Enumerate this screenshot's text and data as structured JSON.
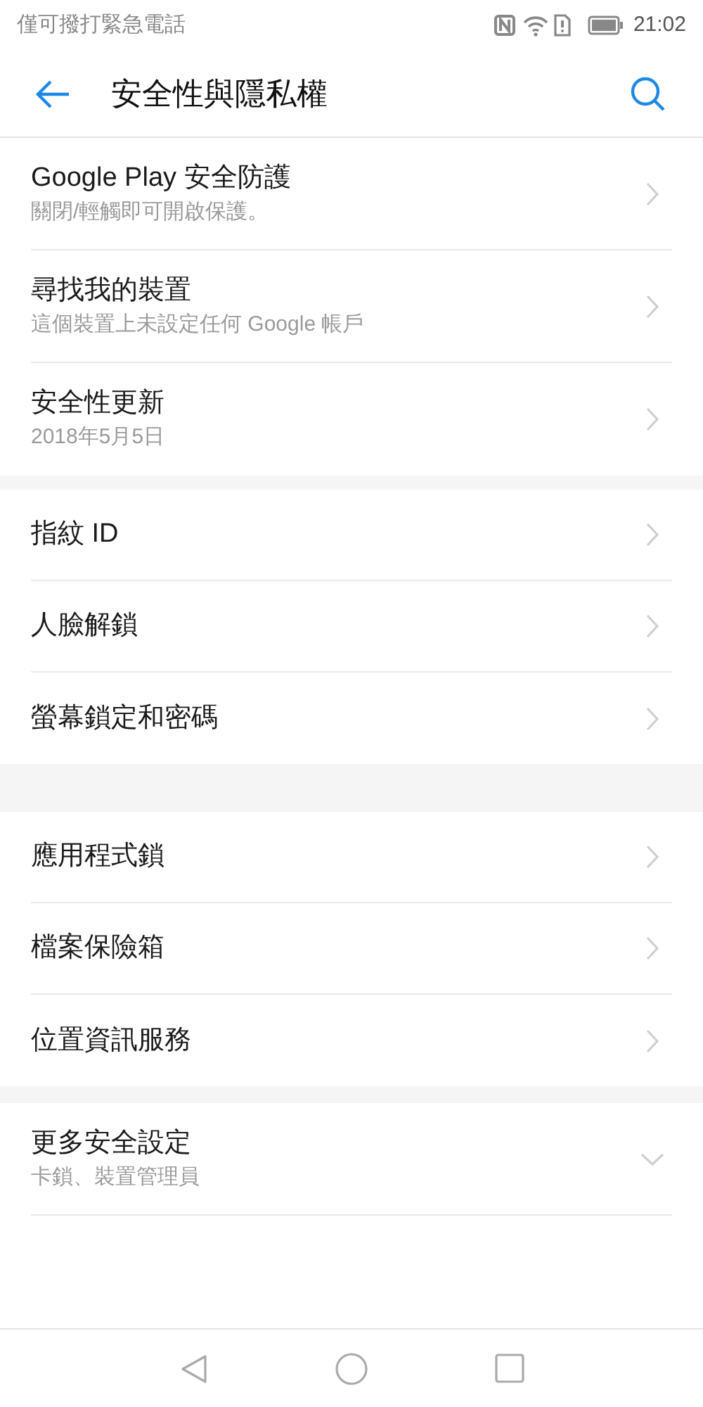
{
  "status_bar": {
    "carrier": "僅可撥打緊急電話",
    "time": "21:02"
  },
  "header": {
    "title": "安全性與隱私權"
  },
  "sections": [
    {
      "items": [
        {
          "kind": "link",
          "title": "Google Play 安全防護",
          "subtitle": "關閉/輕觸即可開啟保護。"
        },
        {
          "kind": "link",
          "title": "尋找我的裝置",
          "subtitle": "這個裝置上未設定任何 Google 帳戶"
        },
        {
          "kind": "link",
          "title": "安全性更新",
          "subtitle": "2018年5月5日"
        }
      ]
    },
    {
      "items": [
        {
          "kind": "link",
          "title": "指紋 ID"
        },
        {
          "kind": "link",
          "title": "人臉解鎖"
        },
        {
          "kind": "link",
          "title": "螢幕鎖定和密碼"
        }
      ]
    },
    {
      "items": [
        {
          "kind": "link",
          "title": "應用程式鎖"
        },
        {
          "kind": "link",
          "title": "檔案保險箱"
        },
        {
          "kind": "link",
          "title": "位置資訊服務"
        }
      ]
    },
    {
      "items": [
        {
          "kind": "expander",
          "title": "更多安全設定",
          "subtitle": "卡鎖、裝置管理員"
        }
      ]
    }
  ]
}
